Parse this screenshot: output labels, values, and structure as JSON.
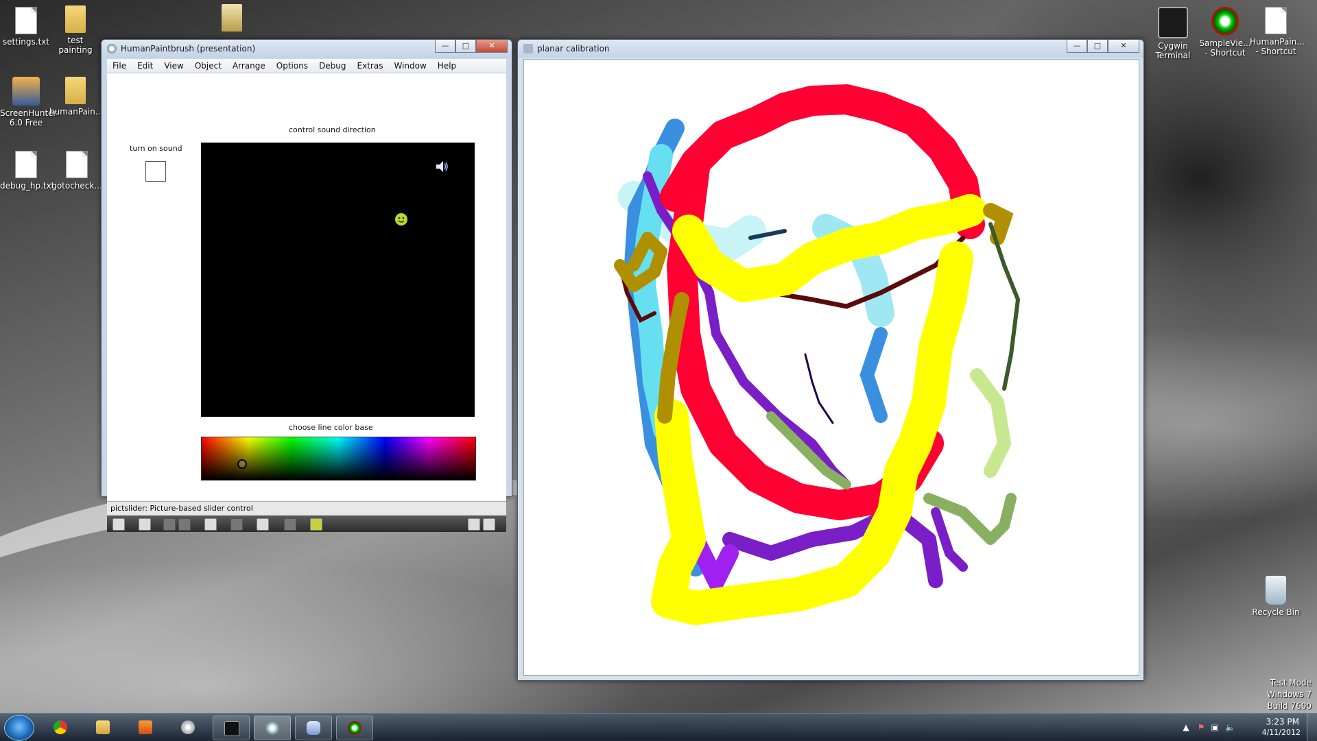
{
  "desktop_icons": [
    {
      "label": "settings.txt",
      "type": "doc"
    },
    {
      "label": "test painting",
      "type": "folder"
    },
    {
      "label": "",
      "type": "archive"
    },
    {
      "label": "ScreenHunter 6.0 Free",
      "type": "app"
    },
    {
      "label": "humanPain...",
      "type": "folder"
    },
    {
      "label": "debug_hp.txt",
      "type": "doc"
    },
    {
      "label": "gotocheck...",
      "type": "doc"
    },
    {
      "label": "Cygwin Terminal",
      "type": "app"
    },
    {
      "label": "SampleVie... - Shortcut",
      "type": "app"
    },
    {
      "label": "HumanPain... - Shortcut",
      "type": "app"
    },
    {
      "label": "Recycle Bin",
      "type": "app"
    }
  ],
  "paintbrush_window": {
    "title": "HumanPaintbrush (presentation)",
    "menu": [
      "File",
      "Edit",
      "View",
      "Object",
      "Arrange",
      "Options",
      "Debug",
      "Extras",
      "Window",
      "Help"
    ],
    "sound_direction_label": "control sound direction",
    "turn_on_sound_label": "turn on sound",
    "sound_checkbox_checked": false,
    "color_base_label": "choose line color base",
    "status_text": "pictslider: Picture-based slider control",
    "icons": {
      "speaker": "speaker-icon",
      "cursor": "smiley-icon"
    }
  },
  "calibration_window": {
    "title": "planar calibration"
  },
  "taskbar": {
    "apps": [
      "chrome-icon",
      "explorer-icon",
      "media-player-icon",
      "disc-icon",
      "terminal-icon",
      "paintbrush-icon",
      "opengl-icon",
      "sampleviewer-icon"
    ],
    "time": "3:23 PM",
    "date": "4/11/2012"
  },
  "watermark": {
    "line1": "Test Mode",
    "line2": "Windows 7",
    "line3": "Build 7600"
  },
  "colors": {
    "red": "#ff0033",
    "yellow": "#ffff00",
    "cyan": "#66e8f5",
    "blue": "#3a8fe0",
    "purple": "#7a1ec8",
    "olive": "#b08f00",
    "green": "#88b060",
    "darkred": "#5a0a0a"
  }
}
